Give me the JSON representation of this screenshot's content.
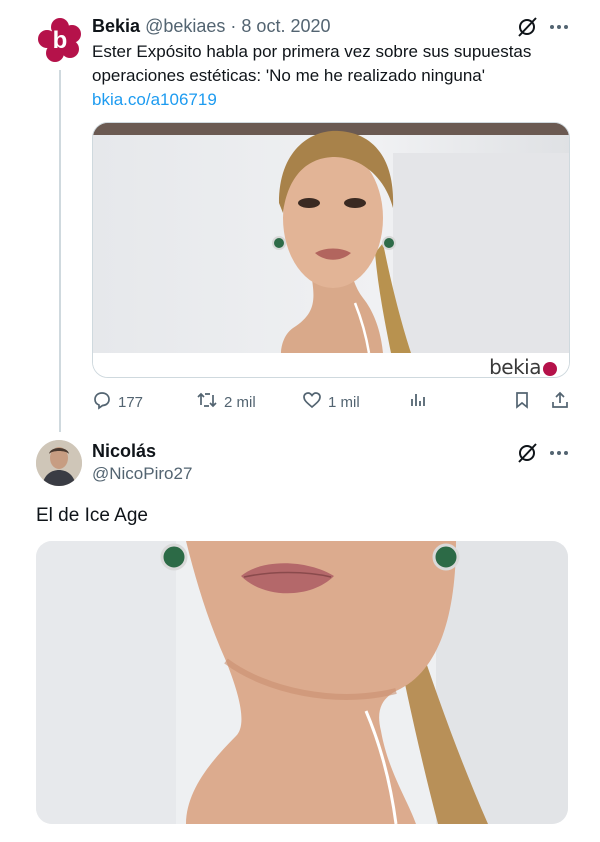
{
  "tweet1": {
    "author_name": "Bekia",
    "handle": "@bekiaes",
    "separator": "·",
    "date": "8 oct. 2020",
    "text": "Ester Expósito habla por primera vez sobre sus supuestas operaciones estéticas: 'No me he realizado ninguna'",
    "link": "bkia.co/a106719",
    "card_brand": "bekia",
    "avatar_letter": "b",
    "brand_color": "#b5124a",
    "actions": {
      "replies": "177",
      "reposts": "2 mil",
      "likes": "1 mil"
    },
    "icons": [
      "grok-icon",
      "more-icon",
      "reply-icon",
      "repost-icon",
      "like-icon",
      "views-icon",
      "bookmark-icon",
      "share-icon"
    ]
  },
  "tweet2": {
    "author_name": "Nicolás",
    "handle": "@NicoPiro27",
    "text": "El de Ice Age"
  },
  "colors": {
    "text": "#0f1419",
    "muted": "#536471",
    "link": "#1d9bf0",
    "border": "#cfd9de"
  }
}
